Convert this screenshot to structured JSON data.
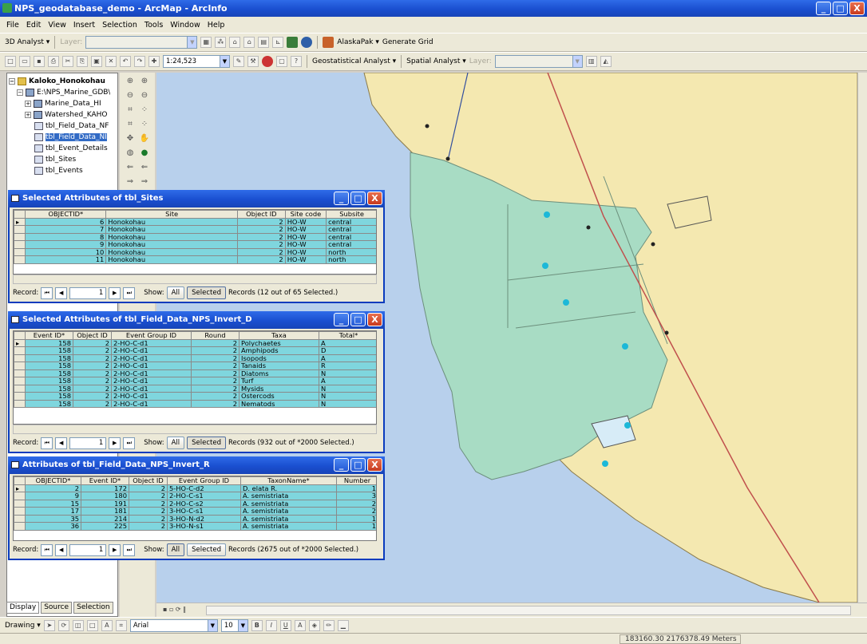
{
  "window": {
    "title": "NPS_geodatabase_demo - ArcMap - ArcInfo",
    "min": "_",
    "max": "□",
    "close": "X"
  },
  "menu": [
    "File",
    "Edit",
    "View",
    "Insert",
    "Selection",
    "Tools",
    "Window",
    "Help"
  ],
  "toolbar1": {
    "analyst_3d": "3D Analyst ▾",
    "layer_label": "Layer:",
    "alaskapak": "AlaskaPak ▾",
    "generate_grid": "Generate Grid"
  },
  "toolbar2": {
    "scale": "1:24,523",
    "geostat": "Geostatistical Analyst ▾",
    "spatial": "Spatial Analyst ▾",
    "layer_label": "Layer:"
  },
  "toc": {
    "items": [
      {
        "label": "Kaloko_Honokohau",
        "expander": "−"
      },
      {
        "label": "E:\\NPS_Marine_GDB\\",
        "expander": "−"
      },
      {
        "label": "Marine_Data_HI",
        "expander": "+"
      },
      {
        "label": "Watershed_KAHO",
        "expander": "+"
      },
      {
        "label": "tbl_Field_Data_NF"
      },
      {
        "label": "tbl_Field_Data_NI"
      },
      {
        "label": "tbl_Event_Details"
      },
      {
        "label": "tbl_Sites"
      },
      {
        "label": "tbl_Events"
      }
    ],
    "tabs": [
      "Display",
      "Source",
      "Selection"
    ]
  },
  "win1": {
    "title": "Selected Attributes of tbl_Sites",
    "columns": [
      "OBJECTID*",
      "Site",
      "Object ID",
      "Site code",
      "Subsite"
    ],
    "rows": [
      [
        "6",
        "Honokohau",
        "2",
        "HO-W",
        "central"
      ],
      [
        "7",
        "Honokohau",
        "2",
        "HO-W",
        "central"
      ],
      [
        "8",
        "Honokohau",
        "2",
        "HO-W",
        "central"
      ],
      [
        "9",
        "Honokohau",
        "2",
        "HO-W",
        "central"
      ],
      [
        "10",
        "Honokohau",
        "2",
        "HO-W",
        "north"
      ],
      [
        "11",
        "Honokohau",
        "2",
        "HO-W",
        "north"
      ]
    ],
    "nav": {
      "record": "Record:",
      "num": "1",
      "show": "Show:",
      "all": "All",
      "selected": "Selected",
      "records": "Records  (12 out of 65 Selected.)"
    }
  },
  "win2": {
    "title": "Selected Attributes of tbl_Field_Data_NPS_Invert_D",
    "columns": [
      "Event ID*",
      "Object ID",
      "Event Group ID",
      "Round",
      "Taxa",
      "Total*"
    ],
    "rows": [
      [
        "158",
        "2",
        "2-HO-C-d1",
        "2",
        "Polychaetes",
        "A"
      ],
      [
        "158",
        "2",
        "2-HO-C-d1",
        "2",
        "Amphipods",
        "D"
      ],
      [
        "158",
        "2",
        "2-HO-C-d1",
        "2",
        "Isopods",
        "A"
      ],
      [
        "158",
        "2",
        "2-HO-C-d1",
        "2",
        "Tanaids",
        "R"
      ],
      [
        "158",
        "2",
        "2-HO-C-d1",
        "2",
        "Diatoms",
        "N"
      ],
      [
        "158",
        "2",
        "2-HO-C-d1",
        "2",
        "Turf",
        "A"
      ],
      [
        "158",
        "2",
        "2-HO-C-d1",
        "2",
        "Mysids",
        "N"
      ],
      [
        "158",
        "2",
        "2-HO-C-d1",
        "2",
        "Ostercods",
        "N"
      ],
      [
        "158",
        "2",
        "2-HO-C-d1",
        "2",
        "Nematods",
        "N"
      ]
    ],
    "nav": {
      "record": "Record:",
      "num": "1",
      "show": "Show:",
      "all": "All",
      "selected": "Selected",
      "records": "Records  (932 out of *2000 Selected.)"
    }
  },
  "win3": {
    "title": "Attributes of tbl_Field_Data_NPS_Invert_R",
    "columns": [
      "OBJECTID*",
      "Event ID*",
      "Object ID",
      "Event Group ID",
      "TaxonName*",
      "Number"
    ],
    "rows": [
      [
        "2",
        "172",
        "2",
        "5-HO-C-d2",
        "D. elata R.",
        "1"
      ],
      [
        "9",
        "180",
        "2",
        "2-HO-C-s1",
        "A. semistriata",
        "3"
      ],
      [
        "15",
        "191",
        "2",
        "2-HO-C-s2",
        "A. semistriata",
        "2"
      ],
      [
        "17",
        "181",
        "2",
        "3-HO-C-s1",
        "A. semistriata",
        "2"
      ],
      [
        "35",
        "214",
        "2",
        "3-HO-N-d2",
        "A. semistriata",
        "1"
      ],
      [
        "36",
        "225",
        "2",
        "3-HO-N-s1",
        "A. semistriata",
        "1"
      ]
    ],
    "nav": {
      "record": "Record:",
      "num": "1",
      "show": "Show:",
      "all": "All",
      "selected": "Selected",
      "records": "Records  (2675 out of *2000 Selected.)"
    }
  },
  "drawing": {
    "label": "Drawing ▾",
    "font": "Arial",
    "size": "10",
    "bold": "B",
    "italic": "I",
    "underline": "U"
  },
  "status": {
    "coords": "183160.30  2176378.49 Meters"
  },
  "colors": {
    "title_blue": "#1a4fd0",
    "selected_row": "#7fd6de",
    "land": "#f4e8b0",
    "water": "#b8d0ec",
    "park": "#a8dcc4",
    "site_point": "#1cb8d8",
    "road": "#c0504d"
  }
}
